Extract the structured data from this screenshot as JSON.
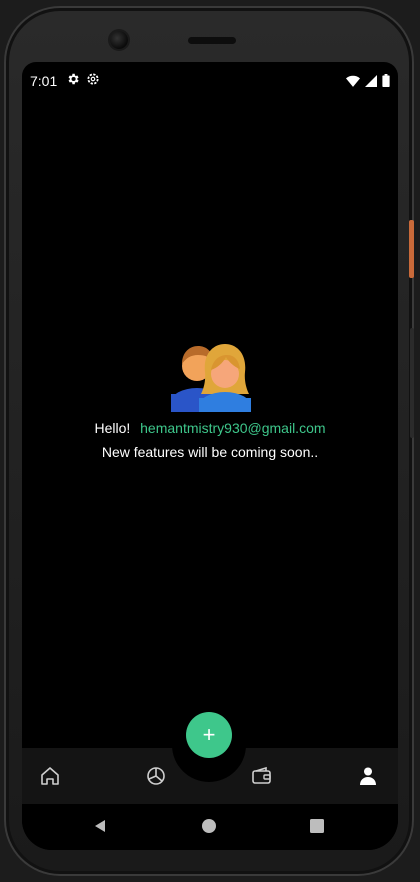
{
  "status_bar": {
    "time": "7:01",
    "icons": [
      "gear-icon",
      "settings-cog-icon",
      "wifi-icon",
      "cell-signal-icon",
      "battery-icon"
    ]
  },
  "main": {
    "avatar_icon": "people-icon",
    "hello_label": "Hello!",
    "email": "hemantmistry930@gmail.com",
    "message": "New features will be coming soon.."
  },
  "fab": {
    "label": "+",
    "color": "#3ec78b"
  },
  "bottom_nav": {
    "items": [
      {
        "icon": "home-icon",
        "active": false
      },
      {
        "icon": "pie-chart-icon",
        "active": false
      },
      {
        "icon": "wallet-icon",
        "active": false
      },
      {
        "icon": "profile-icon",
        "active": true
      }
    ]
  },
  "system_nav": [
    "back-icon",
    "home-button-icon",
    "recents-icon"
  ],
  "colors": {
    "accent": "#3ec78b",
    "background": "#000000",
    "nav_background": "#141414"
  }
}
